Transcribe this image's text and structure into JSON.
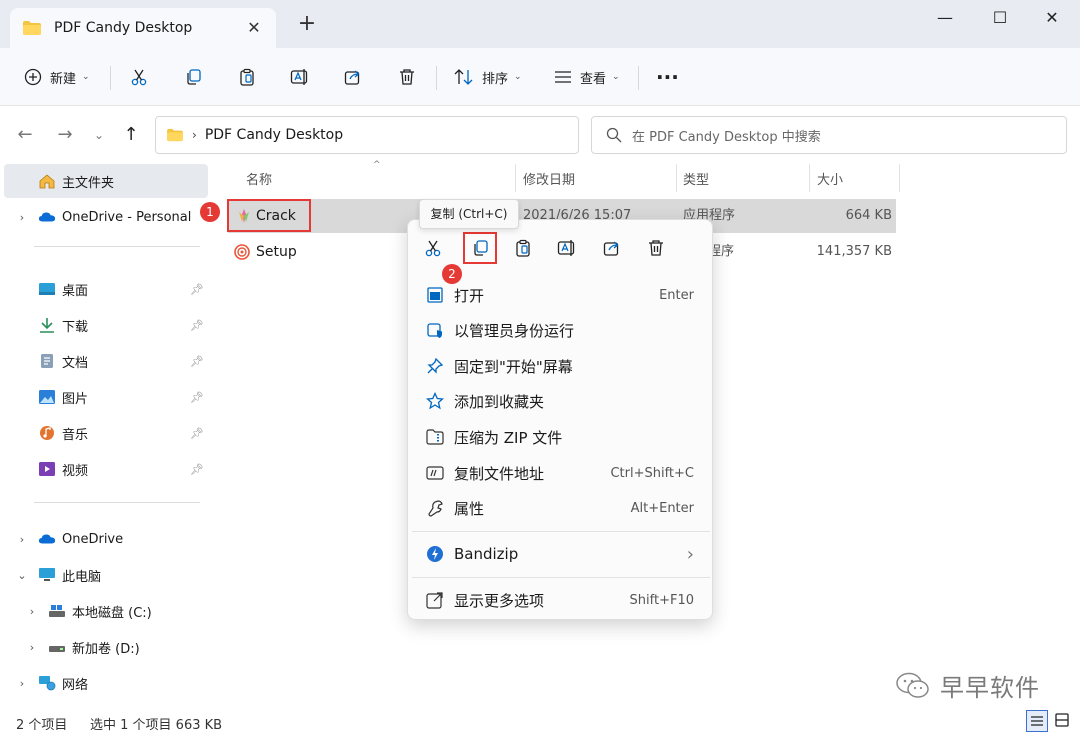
{
  "window": {
    "tab_title": "PDF Candy Desktop",
    "tab_close": "✕",
    "new_tab": "+",
    "minimize": "—",
    "maximize": "☐",
    "close": "✕"
  },
  "toolbar": {
    "new_label": "新建",
    "sort_label": "排序",
    "view_label": "查看",
    "more": "···"
  },
  "address": {
    "path": "PDF Candy Desktop",
    "search_placeholder": "在 PDF Candy Desktop 中搜索"
  },
  "sidebar": {
    "items": [
      {
        "label": "主文件夹",
        "icon": "home-icon"
      },
      {
        "label": "OneDrive - Personal",
        "icon": "onedrive-icon"
      },
      {
        "label": "桌面",
        "icon": "desktop-icon"
      },
      {
        "label": "下载",
        "icon": "download-icon"
      },
      {
        "label": "文档",
        "icon": "document-icon"
      },
      {
        "label": "图片",
        "icon": "pictures-icon"
      },
      {
        "label": "音乐",
        "icon": "music-icon"
      },
      {
        "label": "视频",
        "icon": "video-icon"
      },
      {
        "label": "OneDrive",
        "icon": "onedrive-icon"
      },
      {
        "label": "此电脑",
        "icon": "computer-icon"
      },
      {
        "label": "本地磁盘 (C:)",
        "icon": "drive-icon"
      },
      {
        "label": "新加卷 (D:)",
        "icon": "drive-icon"
      },
      {
        "label": "网络",
        "icon": "network-icon"
      }
    ]
  },
  "files": {
    "columns": [
      "名称",
      "修改日期",
      "类型",
      "大小"
    ],
    "rows": [
      {
        "name": "Crack",
        "date": "2021/6/26 15:07",
        "type": "应用程序",
        "size": "664 KB"
      },
      {
        "name": "Setup",
        "date": "",
        "type": "程序",
        "size": "141,357 KB"
      }
    ]
  },
  "annotations": {
    "badge1": "1",
    "badge2": "2"
  },
  "tooltip": "复制 (Ctrl+C)",
  "context_menu": {
    "items": [
      {
        "label": "打开",
        "shortcut": "Enter"
      },
      {
        "label": "以管理员身份运行",
        "shortcut": ""
      },
      {
        "label": "固定到\"开始\"屏幕",
        "shortcut": ""
      },
      {
        "label": "添加到收藏夹",
        "shortcut": ""
      },
      {
        "label": "压缩为 ZIP 文件",
        "shortcut": ""
      },
      {
        "label": "复制文件地址",
        "shortcut": "Ctrl+Shift+C"
      },
      {
        "label": "属性",
        "shortcut": "Alt+Enter"
      },
      {
        "label": "Bandizip",
        "shortcut": "›"
      },
      {
        "label": "显示更多选项",
        "shortcut": "Shift+F10"
      }
    ]
  },
  "status": {
    "count": "2 个项目",
    "selected": "选中 1 个项目  663 KB"
  },
  "watermark": "早早软件",
  "colors": {
    "accent": "#0067c0",
    "highlight_red": "#e53935",
    "folder": "#f4c542"
  }
}
